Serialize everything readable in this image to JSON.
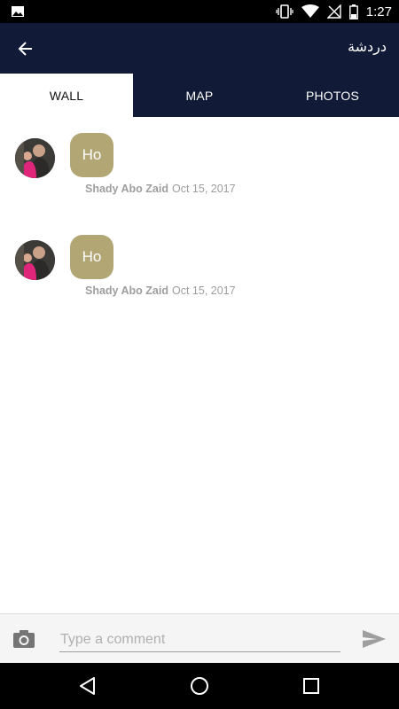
{
  "status_bar": {
    "time": "1:27",
    "icons": [
      "image-icon",
      "vibrate-icon",
      "wifi-icon",
      "no-signal-icon",
      "battery-icon"
    ]
  },
  "app_bar": {
    "title": "دردشة",
    "back_icon": "back-arrow-icon"
  },
  "tabs": [
    {
      "label": "WALL",
      "active": true
    },
    {
      "label": "MAP",
      "active": false
    },
    {
      "label": "PHOTOS",
      "active": false
    }
  ],
  "messages": [
    {
      "text": "Ho",
      "author": "Shady Abo Zaid",
      "date": "Oct 15, 2017"
    },
    {
      "text": "Ho",
      "author": "Shady Abo Zaid",
      "date": "Oct 15, 2017"
    }
  ],
  "composer": {
    "placeholder": "Type a comment",
    "value": "",
    "camera_icon": "camera-icon",
    "send_icon": "send-icon"
  },
  "colors": {
    "app_bar": "#111a36",
    "bubble": "#b3a675",
    "meta_text": "#9e9e9e"
  }
}
